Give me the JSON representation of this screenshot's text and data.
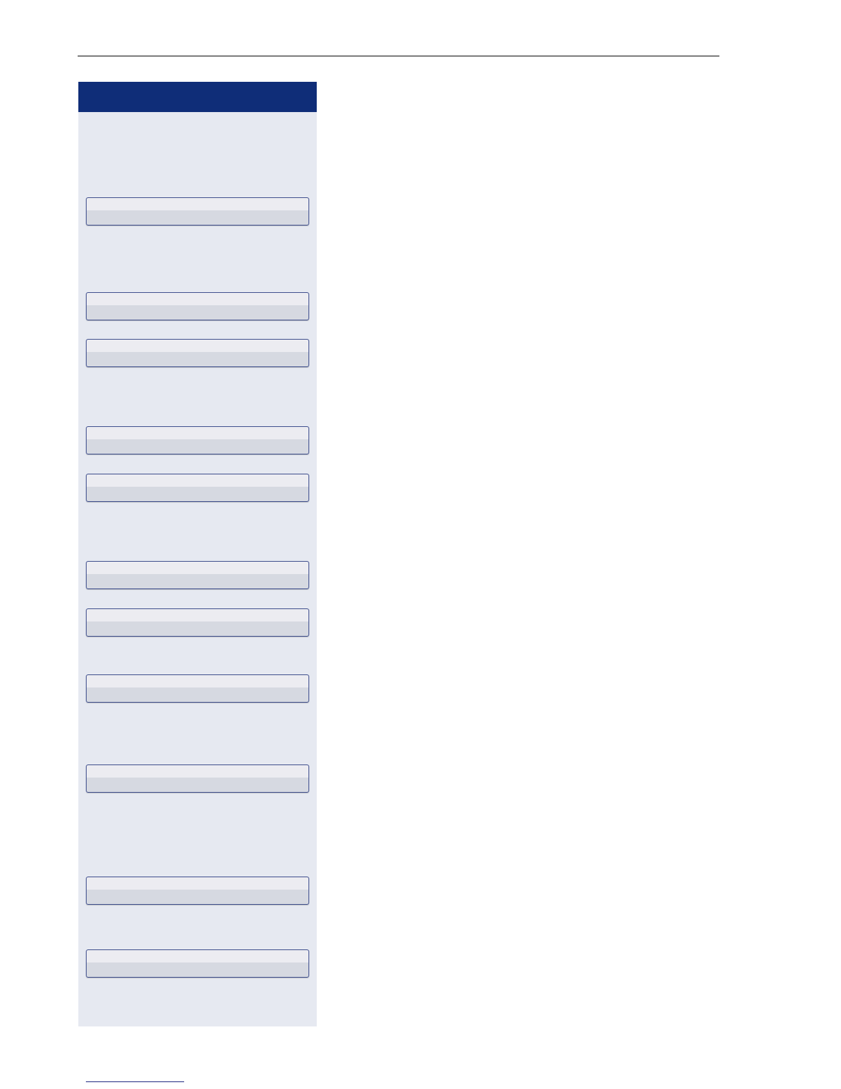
{
  "side_panel": {
    "buttons": [
      {
        "kind": "blank"
      },
      {
        "kind": "blank"
      },
      {
        "kind": "blank"
      },
      {
        "kind": "blank"
      },
      {
        "kind": "blank"
      },
      {
        "kind": "blank"
      },
      {
        "kind": "blank"
      },
      {
        "kind": "blank"
      },
      {
        "kind": "blank"
      },
      {
        "kind": "blank"
      },
      {
        "kind": "blank"
      }
    ]
  }
}
